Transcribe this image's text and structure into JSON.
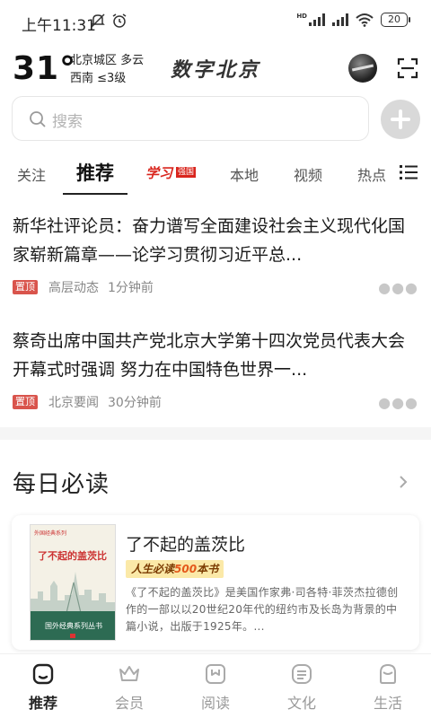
{
  "status_bar": {
    "time": "上午11:31",
    "hd_label": "HD",
    "battery": "20"
  },
  "header": {
    "temperature": "31°",
    "weather_line1": "北京城区 多云",
    "weather_line2": "西南 ≤3级",
    "app_title": "数字北京"
  },
  "search": {
    "placeholder": "搜索"
  },
  "tabs": [
    {
      "label": "关注"
    },
    {
      "label": "推荐",
      "active": true
    },
    {
      "label": "学习强国",
      "logo": true
    },
    {
      "label": "本地"
    },
    {
      "label": "视频"
    },
    {
      "label": "热点"
    }
  ],
  "xxqg_logo_top": "学习",
  "xxqg_logo_sub": "强国",
  "news": [
    {
      "title": "新华社评论员：奋力谱写全面建设社会主义现代化国家崭新篇章——论学习贯彻习近平总...",
      "pin": "置顶",
      "source": "高层动态",
      "time": "1分钟前"
    },
    {
      "title": "蔡奇出席中国共产党北京大学第十四次党员代表大会开幕式时强调 努力在中国特色世界一...",
      "pin": "置顶",
      "source": "北京要闻",
      "time": "30分钟前"
    }
  ],
  "daily_read": {
    "section_title": "每日必读",
    "book": {
      "cover_series_top": "外国经典系列",
      "cover_title": "了不起的盖茨比",
      "cover_series": "国外经典系列丛书",
      "title": "了不起的盖茨比",
      "tag_prefix": "人生必读",
      "tag_highlight": "500",
      "tag_suffix": "本书",
      "description": "《了不起的盖茨比》是美国作家弗·司各特·菲茨杰拉德创作的一部以以20世纪20年代的纽约市及长岛为背景的中篇小说，出版于1925年。..."
    }
  },
  "bottom_nav": [
    {
      "label": "推荐",
      "icon": "home-icon",
      "active": true
    },
    {
      "label": "会员",
      "icon": "crown-icon"
    },
    {
      "label": "阅读",
      "icon": "book-icon"
    },
    {
      "label": "文化",
      "icon": "culture-icon"
    },
    {
      "label": "生活",
      "icon": "life-icon"
    }
  ],
  "colors": {
    "accent_red": "#d9251d",
    "pin_red": "#d9544c",
    "tag_bg": "#fbe9a8"
  }
}
